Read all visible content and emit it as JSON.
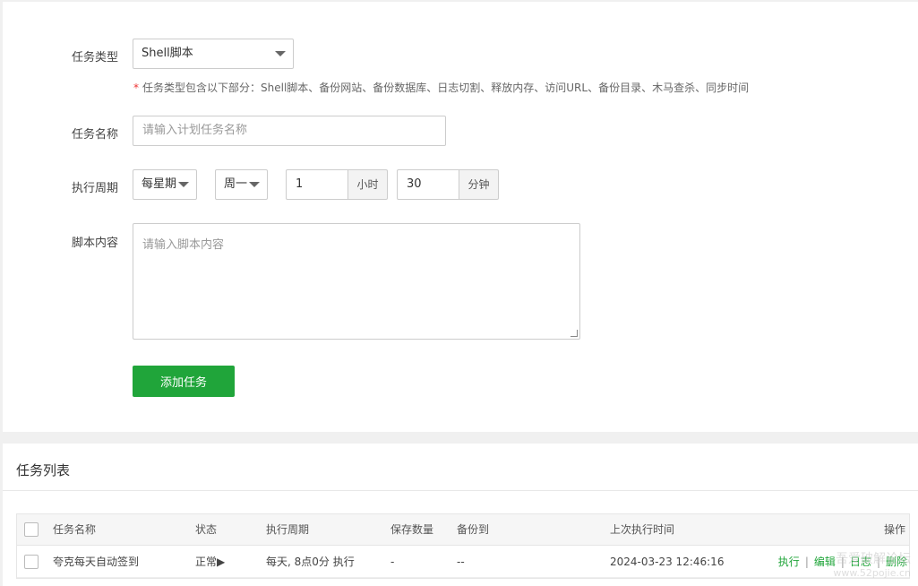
{
  "form": {
    "task_type": {
      "label": "任务类型",
      "value": "Shell脚本"
    },
    "hint": {
      "star": "*",
      "text": "任务类型包含以下部分：Shell脚本、备份网站、备份数据库、日志切割、释放内存、访问URL、备份目录、木马查杀、同步时间"
    },
    "task_name": {
      "label": "任务名称",
      "placeholder": "请输入计划任务名称"
    },
    "cycle": {
      "label": "执行周期",
      "period": "每星期",
      "weekday": "周一",
      "hour": "1",
      "hour_unit": "小时",
      "minute": "30",
      "minute_unit": "分钟"
    },
    "script": {
      "label": "脚本内容",
      "placeholder": "请输入脚本内容"
    },
    "add_button": "添加任务"
  },
  "list": {
    "title": "任务列表",
    "columns": {
      "name": "任务名称",
      "status": "状态",
      "cycle": "执行周期",
      "keep": "保存数量",
      "backup_to": "备份到",
      "last_run": "上次执行时间",
      "ops": "操作"
    },
    "rows": [
      {
        "name": "夸克每天自动签到",
        "status": "正常▶",
        "cycle": "每天, 8点0分 执行",
        "keep": "-",
        "backup_to": "--",
        "last_run": "2024-03-23 12:46:16",
        "ops": {
          "run": "执行",
          "sep1": "|",
          "edit": "编辑",
          "sep2": "|",
          "log": "日志",
          "sep3": "|",
          "delete": "删除"
        }
      }
    ]
  },
  "watermark": {
    "line1": "吾爱破解论坛",
    "line2": "www.52pojie.cn"
  },
  "colors": {
    "accent": "#20a53a",
    "required": "#e33333"
  }
}
